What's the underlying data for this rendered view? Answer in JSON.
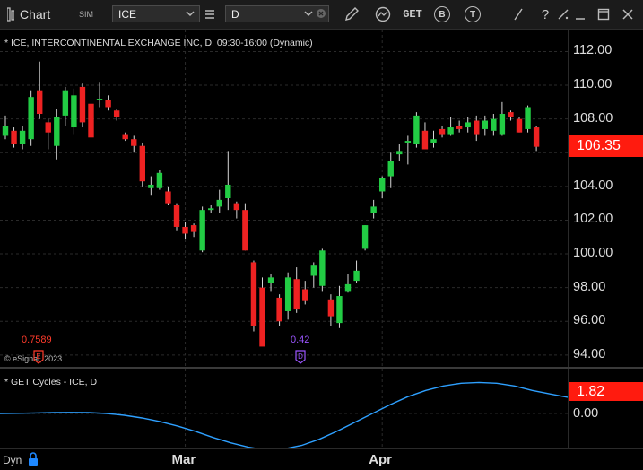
{
  "toolbar": {
    "chart_label": "Chart",
    "sim_label": "SIM",
    "symbol_value": "ICE",
    "interval_value": "D",
    "get_label": "GET",
    "b_label": "B",
    "t_label": "T",
    "help_label": "?"
  },
  "chart_title": "* ICE, INTERCONTINENTAL EXCHANGE INC, D, 09:30-16:00 (Dynamic)",
  "copyright": "© eSignal, 2023",
  "last_price": "106.35",
  "annotations": {
    "left_value": "0.7589",
    "right_value": "0.42"
  },
  "indicator": {
    "title": "* GET Cycles - ICE, D",
    "last_value": "1.82",
    "zero_label": "0.00"
  },
  "bottom": {
    "dyn_label": "Dyn"
  },
  "colors": {
    "up": "#22cc44",
    "down": "#ee2222",
    "cycle_line": "#2ea0ff",
    "last_box": "#ff1b0f"
  },
  "chart_data": [
    {
      "type": "candlestick",
      "title": "* ICE, INTERCONTINENTAL EXCHANGE INC, D, 09:30-16:00 (Dynamic)",
      "x": [
        "d1",
        "d2",
        "d3",
        "d4",
        "d5",
        "d6",
        "d7",
        "d8",
        "d9",
        "d10",
        "d11",
        "d12",
        "d13",
        "d14",
        "d15",
        "d16",
        "d17",
        "d18",
        "d19",
        "d20",
        "d21",
        "d22",
        "d23",
        "d24",
        "d25",
        "d26",
        "d27",
        "d28",
        "d29",
        "d30",
        "d31",
        "d32",
        "d33",
        "d34",
        "d35",
        "d36",
        "d37",
        "d38",
        "d39",
        "d40",
        "d41",
        "d42",
        "d43",
        "d44",
        "d45",
        "d46",
        "d47",
        "d48",
        "d49",
        "d50",
        "d51",
        "d52",
        "d53",
        "d54",
        "d55",
        "d56",
        "d57",
        "d58",
        "d59",
        "d60",
        "d61",
        "d62",
        "d63"
      ],
      "x_tick_labels": [
        {
          "index": 21,
          "label": "Mar"
        },
        {
          "index": 44,
          "label": "Apr"
        }
      ],
      "y_ticks": [
        94,
        96,
        98,
        100,
        102,
        104,
        106,
        108,
        110,
        112
      ],
      "ylim": [
        93.3,
        113.3
      ],
      "series": [
        {
          "name": "ICE",
          "ohlc": [
            [
              107.0,
              108.2,
              106.8,
              107.6
            ],
            [
              107.3,
              107.5,
              106.3,
              106.5
            ],
            [
              106.5,
              107.6,
              106.2,
              107.3
            ],
            [
              106.8,
              109.7,
              106.4,
              109.3
            ],
            [
              109.7,
              111.4,
              108.0,
              108.3
            ],
            [
              107.8,
              108.0,
              106.2,
              107.2
            ],
            [
              106.4,
              108.6,
              105.6,
              108.1
            ],
            [
              108.2,
              109.9,
              107.6,
              109.7
            ],
            [
              107.5,
              109.8,
              107.1,
              109.4
            ],
            [
              109.9,
              110.1,
              107.5,
              107.8
            ],
            [
              108.9,
              109.1,
              106.8,
              106.9
            ],
            [
              109.1,
              110.2,
              108.7,
              109.2
            ],
            [
              109.1,
              109.4,
              108.5,
              108.7
            ],
            [
              108.5,
              108.6,
              107.9,
              108.1
            ],
            [
              107.1,
              107.2,
              106.7,
              106.8
            ],
            [
              106.8,
              107.0,
              106.0,
              106.4
            ],
            [
              106.4,
              106.6,
              104.0,
              104.3
            ],
            [
              103.9,
              104.6,
              103.5,
              104.1
            ],
            [
              103.9,
              105.0,
              103.8,
              104.8
            ],
            [
              103.7,
              104.0,
              102.9,
              103.0
            ],
            [
              102.9,
              103.0,
              101.4,
              101.6
            ],
            [
              101.6,
              101.9,
              100.9,
              101.2
            ],
            [
              101.7,
              101.8,
              101.0,
              101.3
            ],
            [
              100.2,
              102.8,
              100.1,
              102.6
            ],
            [
              102.6,
              102.9,
              102.4,
              102.7
            ],
            [
              102.8,
              103.8,
              102.4,
              103.2
            ],
            [
              103.3,
              106.1,
              102.6,
              104.1
            ],
            [
              103.0,
              103.1,
              102.1,
              102.6
            ],
            [
              102.6,
              103.0,
              100.2,
              100.2
            ],
            [
              99.5,
              99.6,
              95.4,
              95.7
            ],
            [
              98.0,
              98.6,
              95.0,
              94.5
            ],
            [
              98.3,
              98.8,
              97.8,
              98.6
            ],
            [
              97.4,
              97.6,
              95.7,
              96.0
            ],
            [
              96.6,
              98.9,
              96.1,
              98.6
            ],
            [
              98.5,
              99.2,
              96.5,
              96.7
            ],
            [
              97.9,
              98.4,
              97.0,
              97.2
            ],
            [
              98.7,
              99.5,
              98.0,
              99.3
            ],
            [
              98.1,
              100.3,
              97.8,
              100.2
            ],
            [
              97.3,
              97.6,
              95.7,
              96.3
            ],
            [
              95.9,
              98.1,
              95.6,
              97.5
            ],
            [
              97.8,
              98.8,
              97.7,
              98.2
            ],
            [
              98.4,
              99.6,
              98.3,
              99.0
            ],
            [
              100.3,
              101.7,
              100.2,
              101.7
            ],
            [
              102.4,
              103.2,
              102.1,
              102.8
            ],
            [
              103.7,
              104.6,
              103.3,
              104.5
            ],
            [
              104.6,
              106.0,
              103.9,
              105.5
            ],
            [
              105.9,
              106.5,
              105.5,
              106.1
            ],
            [
              106.6,
              107.0,
              105.3,
              106.7
            ],
            [
              106.5,
              108.4,
              106.3,
              108.2
            ],
            [
              107.3,
              107.8,
              106.4,
              106.2
            ],
            [
              106.6,
              107.3,
              106.3,
              106.8
            ],
            [
              107.4,
              107.6,
              106.9,
              107.1
            ],
            [
              107.1,
              108.1,
              107.0,
              107.5
            ],
            [
              107.6,
              107.9,
              107.2,
              107.4
            ],
            [
              107.5,
              108.1,
              107.2,
              107.8
            ],
            [
              107.9,
              108.2,
              106.7,
              107.1
            ],
            [
              107.4,
              108.2,
              107.0,
              107.9
            ],
            [
              107.3,
              108.3,
              107.0,
              108.0
            ],
            [
              107.1,
              109.0,
              107.0,
              108.3
            ],
            [
              108.4,
              108.5,
              107.9,
              108.1
            ],
            [
              108.0,
              108.1,
              107.2,
              107.2
            ],
            [
              107.4,
              108.8,
              107.2,
              108.7
            ],
            [
              107.5,
              107.6,
              106.1,
              106.35
            ]
          ]
        }
      ]
    },
    {
      "type": "line",
      "title": "* GET Cycles - ICE, D",
      "y_ticks": [
        0.0
      ],
      "series": [
        {
          "name": "GET Cycles",
          "x": [
            0,
            2,
            4,
            6,
            8,
            10,
            12,
            14,
            16,
            18,
            20,
            22,
            24,
            26,
            28,
            30,
            32,
            34,
            36,
            38,
            40,
            42,
            44,
            46,
            48,
            50,
            52,
            54,
            56,
            58,
            60,
            62,
            64
          ],
          "values": [
            0.0,
            0.02,
            0.06,
            0.1,
            0.12,
            0.1,
            0.0,
            -0.2,
            -0.5,
            -0.9,
            -1.4,
            -2.0,
            -2.7,
            -3.3,
            -3.8,
            -4.1,
            -4.0,
            -3.6,
            -2.9,
            -2.0,
            -1.0,
            0.0,
            1.0,
            1.9,
            2.6,
            3.1,
            3.4,
            3.5,
            3.4,
            3.1,
            2.6,
            2.2,
            1.82
          ]
        }
      ]
    }
  ]
}
